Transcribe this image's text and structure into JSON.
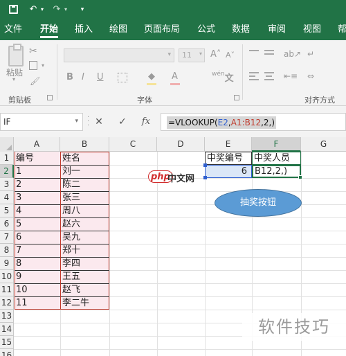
{
  "colors": {
    "brand": "#217346",
    "range_a": "#2f5fd0",
    "range_b": "#c0392b",
    "button_fill": "#5b9bd5",
    "range_fill": "#fbe9ee"
  },
  "titlebar": {
    "save_icon": "save-icon",
    "undo_icon": "undo-icon",
    "redo_icon": "redo-icon",
    "customize_icon": "customize-qat-icon"
  },
  "tabs": [
    "文件",
    "开始",
    "插入",
    "绘图",
    "页面布局",
    "公式",
    "数据",
    "审阅",
    "视图",
    "帮"
  ],
  "active_tab": "开始",
  "ribbon": {
    "paste_label": "粘贴",
    "clipboard_group": "剪贴板",
    "font_group": "字体",
    "font_size_value": "11",
    "grow_label": "A",
    "shrink_label": "A",
    "bold": "B",
    "italic": "I",
    "underline": "U",
    "fill_label": "◆",
    "font_color_label": "A",
    "wen_label": "wén",
    "wen_char": "文",
    "align_group": "对齐方式"
  },
  "formula_bar": {
    "name_box": "IF",
    "cancel_label": "✕",
    "enter_label": "✓",
    "fx_label": "fx",
    "formula_prefix": "=VLOOKUP(",
    "formula_ref1": "E2",
    "formula_sep1": ",",
    "formula_ref2": "A1:B12",
    "formula_suffix": ",2,)"
  },
  "grid": {
    "columns": [
      "A",
      "B",
      "C",
      "D",
      "E",
      "F",
      "G"
    ],
    "selected_column": "F",
    "rows": [
      "1",
      "2",
      "3",
      "4",
      "5",
      "6",
      "7",
      "8",
      "9",
      "10",
      "11",
      "12",
      "13",
      "14",
      "15",
      "16"
    ],
    "selected_row": "2",
    "table_a": [
      "编号",
      "1",
      "2",
      "3",
      "4",
      "5",
      "6",
      "7",
      "8",
      "9",
      "10",
      "11"
    ],
    "table_b": [
      "姓名",
      "刘一",
      "陈二",
      "张三",
      "周八",
      "赵六",
      "吴九",
      "郑十",
      "李四",
      "王五",
      "赵飞",
      "李二牛"
    ],
    "e1": "中奖编号",
    "f1": "中奖人员",
    "e2": "6",
    "f2": "B12,2,)"
  },
  "button_label": "抽奖按钮",
  "watermarks": {
    "php_logo": "php",
    "php_text": "中文网",
    "bottom": "软件技巧"
  }
}
